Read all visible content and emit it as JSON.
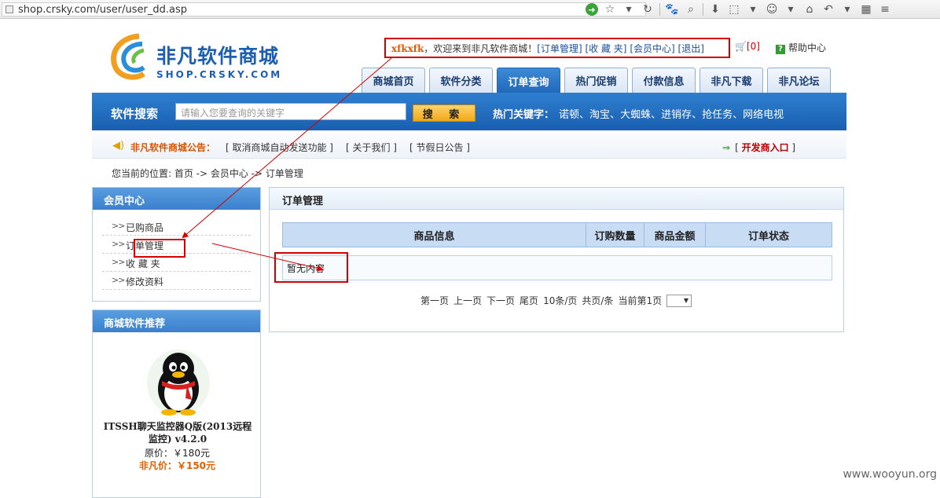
{
  "browser": {
    "url": "shop.crsky.com/user/user_dd.asp"
  },
  "logo": {
    "cn": "非凡软件商城",
    "en": "SHOP.CRSKY.COM"
  },
  "top": {
    "username": "xfkxfk",
    "welcome": "，欢迎来到非凡软件商城！",
    "links": [
      "[订单管理]",
      "[收 藏 夹]",
      "[会员中心]",
      "[退出]"
    ],
    "cart": "[0]",
    "help": "帮助中心"
  },
  "nav": {
    "tabs": [
      "商城首页",
      "软件分类",
      "订单查询",
      "热门促销",
      "付款信息",
      "非凡下载",
      "非凡论坛"
    ],
    "active": "订单查询"
  },
  "search": {
    "label": "软件搜索",
    "placeholder": "请输入您要查询的关键字",
    "button": "搜 索",
    "hot_label": "热门关键字：",
    "hot_words": [
      "诺顿",
      "淘宝",
      "大蜘蛛",
      "进销存",
      "抢任务",
      "网络电视"
    ]
  },
  "notice": {
    "label": "非凡软件商城公告：",
    "items": [
      "[ 取消商城自动发送功能 ]",
      "[ 关于我们 ]",
      "[ 节假日公告 ]"
    ],
    "dev_prefix": "[ ",
    "dev_label": "开发商入口",
    "dev_suffix": " ]"
  },
  "breadcrumb": "您当前的位置:  首页 -> 会员中心 -> 订单管理",
  "sidebar": {
    "member_title": "会员中心",
    "menu": [
      "已购商品",
      "订单管理",
      "收 藏 夹",
      "修改资料"
    ],
    "rec_title": "商城软件推荐",
    "product_name": "ITSSH聊天监控器Q版(2013远程监控) v4.2.0",
    "orig_price": "原价：￥180元",
    "fan_price": "非凡价：￥150元"
  },
  "main": {
    "title": "订单管理",
    "columns": [
      "商品信息",
      "订购数量",
      "商品金额",
      "订单状态"
    ],
    "empty": "暂无内容",
    "pager": [
      "第一页",
      "上一页",
      "下一页",
      "尾页",
      "10条/页",
      "共页/条",
      "当前第1页"
    ]
  },
  "watermark": "www.wooyun.org",
  "colors": {
    "brand": "#1c5fb0",
    "annotation": "#d40000",
    "accent": "#e05b00"
  }
}
